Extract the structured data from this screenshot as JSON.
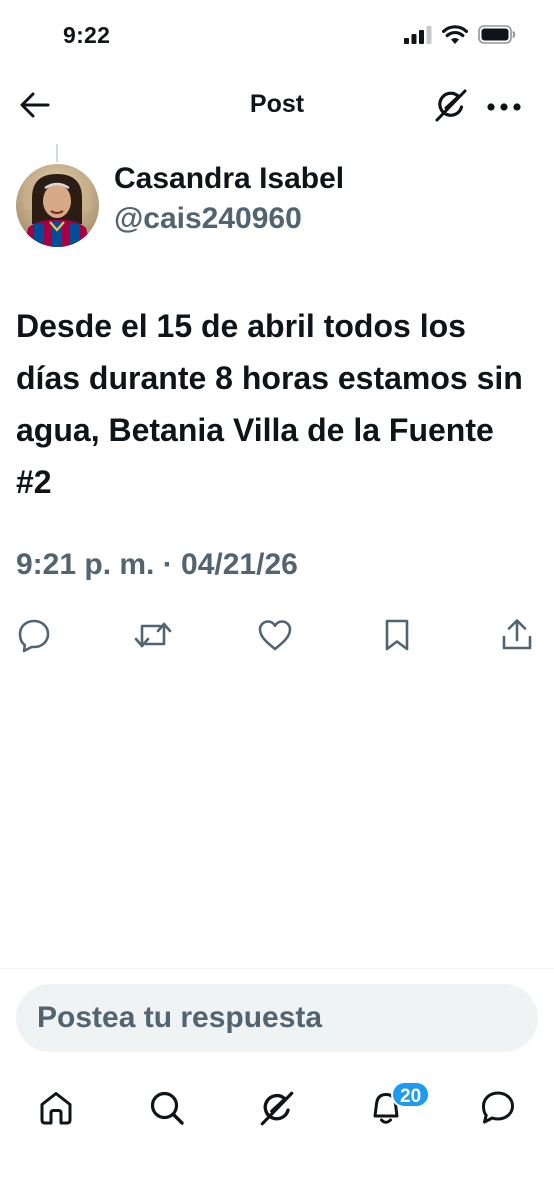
{
  "status_bar": {
    "time": "9:22",
    "icons": [
      "cellular-signal-icon",
      "wifi-icon",
      "battery-icon"
    ]
  },
  "header": {
    "title": "Post",
    "back_icon": "arrow-left-icon",
    "grok_icon": "grok-icon",
    "more_icon": "more-horizontal-icon"
  },
  "post": {
    "author_name": "Casandra Isabel",
    "author_handle": "@cais240960",
    "text": "Desde el 15 de abril todos los días durante 8 horas estamos sin agua, Betania Villa de la Fuente #2",
    "timestamp": "9:21 p. m. · 04/21/26"
  },
  "actions": [
    "reply-icon",
    "repost-icon",
    "like-icon",
    "bookmark-icon",
    "share-icon"
  ],
  "reply": {
    "placeholder": "Postea tu respuesta"
  },
  "tab_bar": {
    "items": [
      "home-icon",
      "search-icon",
      "grok-icon",
      "notifications-icon",
      "messages-icon"
    ],
    "notifications_badge": "20"
  },
  "colors": {
    "primary_text": "#0f1419",
    "secondary_text": "#536471",
    "accent": "#1d9bf0",
    "input_background": "#eff3f4"
  }
}
